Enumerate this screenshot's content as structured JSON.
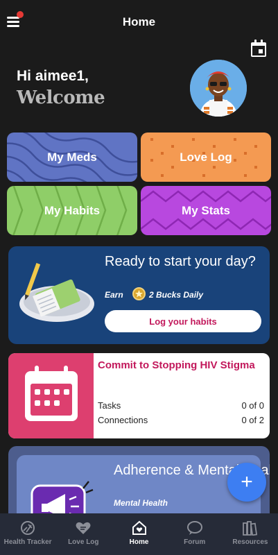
{
  "header": {
    "title": "Home",
    "menu_icon": "hamburger-menu-icon",
    "calendar_icon": "calendar-icon"
  },
  "greeting": {
    "hello": "Hi aimee1,",
    "welcome": "Welcome"
  },
  "tiles": [
    {
      "label": "My Meds",
      "color": "#6074c4"
    },
    {
      "label": "Love Log",
      "color": "#f49a52"
    },
    {
      "label": "My Habits",
      "color": "#8fce68"
    },
    {
      "label": "My Stats",
      "color": "#b848df"
    }
  ],
  "ready_card": {
    "title": "Ready to start your day?",
    "earn": "Earn",
    "bucks": "2 Bucks Daily",
    "button": "Log your habits",
    "color": "#19437a"
  },
  "commit_card": {
    "title": "Commit to Stopping HIV Stigma",
    "rows": [
      {
        "label": "Tasks",
        "value": "0 of 0"
      },
      {
        "label": "Connections",
        "value": "0 of 2"
      }
    ],
    "accent": "#dd3f6f"
  },
  "adherence_card": {
    "title": "Adherence & Mental Health",
    "subtitle": "Mental Health"
  },
  "fab": {
    "label": "+"
  },
  "nav": {
    "items": [
      {
        "label": "Health Tracker",
        "icon": "health-tracker-icon"
      },
      {
        "label": "Love Log",
        "icon": "heart-icon"
      },
      {
        "label": "Home",
        "icon": "home-icon",
        "active": true
      },
      {
        "label": "Forum",
        "icon": "chat-bubble-icon"
      },
      {
        "label": "Resources",
        "icon": "books-icon"
      }
    ]
  }
}
